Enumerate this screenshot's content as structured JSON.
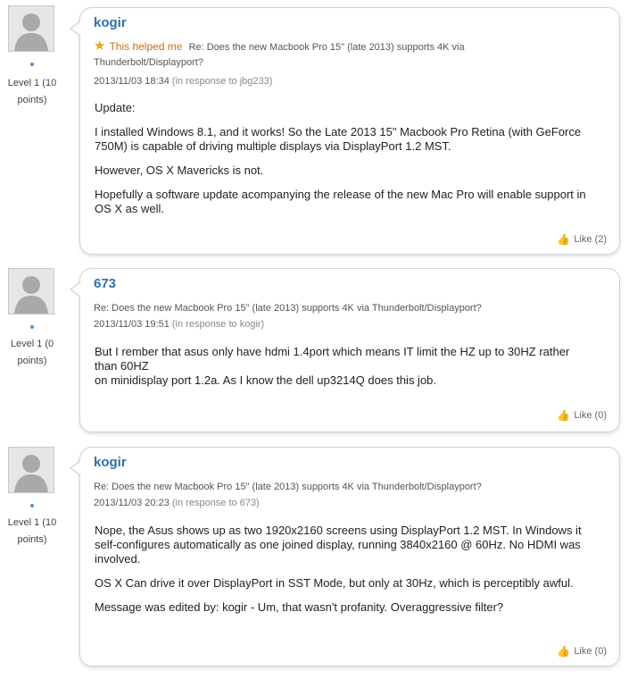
{
  "posts": [
    {
      "author": "kogir",
      "helped_label": "This helped me",
      "subject": "Re: Does the new Macbook Pro 15\" (late 2013) supports 4K via Thunderbolt/Displayport?",
      "subject_line1": "Re: Does the new Macbook Pro 15\" (late 2013) supports 4K via",
      "subject_line2": "Thunderbolt/Displayport?",
      "timestamp": "2013/11/03 18:34",
      "in_response": "(in response to jbg233)",
      "level_line1": "Level 1 (10",
      "level_line2": "points)",
      "paragraphs": [
        "Update:",
        "I installed Windows 8.1, and it works!  So the Late 2013 15\" Macbook Pro Retina (with GeForce 750M) is capable of driving multiple displays via DisplayPort 1.2 MST.",
        "However, OS X Mavericks is not.",
        "Hopefully a software update acompanying the release of the new Mac Pro will enable support in OS X as well."
      ],
      "like_label": "Like (2)"
    },
    {
      "author": "673",
      "subject": "Re: Does the new Macbook Pro 15\" (late 2013) supports 4K via Thunderbolt/Displayport?",
      "timestamp": "2013/11/03 19:51",
      "in_response": "(in response to kogir)",
      "level_line1": "Level 1 (0",
      "level_line2": "points)",
      "paragraphs": [
        "But I rember that asus only have hdmi 1.4port which means IT limit the HZ up to 30HZ rather than 60HZ",
        "on minidisplay port 1.2a. As I know the dell up3214Q does this job."
      ],
      "like_label": "Like (0)"
    },
    {
      "author": "kogir",
      "subject": "Re: Does the new Macbook Pro 15\" (late 2013) supports 4K via Thunderbolt/Displayport?",
      "timestamp": "2013/11/03 20:23",
      "in_response": "(in response to 673)",
      "level_line1": "Level 1 (10",
      "level_line2": "points)",
      "paragraphs": [
        "Nope, the Asus shows up as two 1920x2160 screens using DisplayPort 1.2 MST.  In Windows it self-configures automatically as one joined display, running 3840x2160 @ 60Hz. No HDMI was involved.",
        "OS X Can drive it over DisplayPort in SST Mode, but only at 30Hz, which is perceptibly awful.",
        "Message was edited by: kogir - Um, that wasn't profanity. Overaggressive filter?"
      ],
      "like_label": "Like (0)"
    }
  ],
  "icons": {
    "star": "star-icon",
    "thumb": "thumbs-up-icon",
    "avatar": "default-avatar-icon"
  },
  "colors": {
    "author_link": "#2f6fae",
    "helped": "#c9720c",
    "star": "#f0a419",
    "status_dot": "#4a90d9"
  }
}
